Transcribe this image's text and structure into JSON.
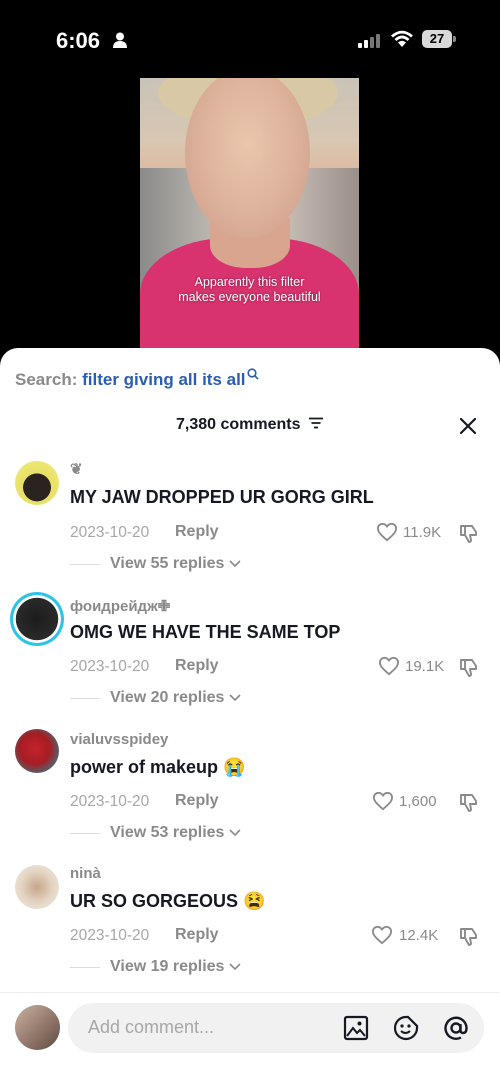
{
  "status": {
    "time": "6:06",
    "battery": "27"
  },
  "video": {
    "caption_line1": "Apparently this filter",
    "caption_line2": "makes everyone beautiful"
  },
  "search": {
    "label": "Search:",
    "query": "filter giving all its all"
  },
  "comments_header": {
    "count_text": "7,380 comments"
  },
  "comments": [
    {
      "username": "❦",
      "text": "MY JAW DROPPED UR GORG GIRL",
      "date": "2023-10-20",
      "reply": "Reply",
      "likes": "11.9K",
      "view_replies": "View 55 replies"
    },
    {
      "username": "фоидрейдж✙",
      "text": "OMG WE HAVE THE SAME TOP",
      "date": "2023-10-20",
      "reply": "Reply",
      "likes": "19.1K",
      "view_replies": "View 20 replies"
    },
    {
      "username": "vialuvsspidey",
      "text": "power of makeup 😭",
      "date": "2023-10-20",
      "reply": "Reply",
      "likes": "1,600",
      "view_replies": "View 53 replies"
    },
    {
      "username": "ninà",
      "text": "UR SO GORGEOUS 😫",
      "date": "2023-10-20",
      "reply": "Reply",
      "likes": "12.4K",
      "view_replies": "View 19 replies"
    }
  ],
  "composer": {
    "placeholder": "Add comment..."
  },
  "colors": {
    "search_query": "#2c5db4",
    "shirt": "#d8336f",
    "text_muted": "#8a8a8a"
  }
}
